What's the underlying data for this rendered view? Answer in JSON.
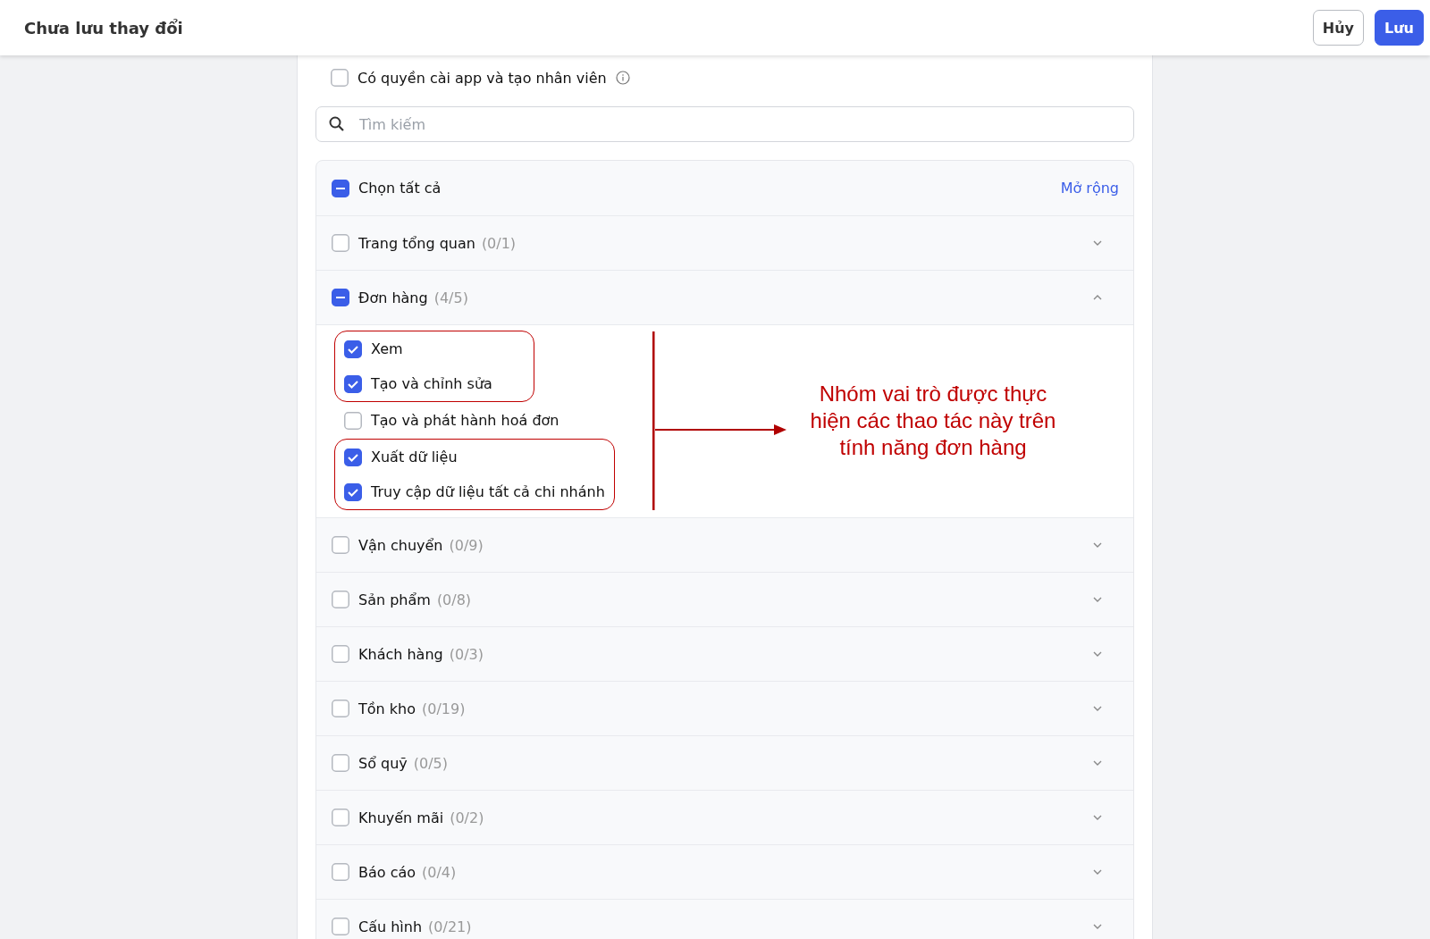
{
  "header": {
    "title": "Chưa lưu thay đổi",
    "buttons": [
      {
        "label": "Hủy",
        "kind": "secondary"
      },
      {
        "label": "Lưu",
        "kind": "primary"
      }
    ]
  },
  "install_permission": {
    "label": "Có quyền cài app và tạo nhân viên",
    "checked": false
  },
  "search": {
    "placeholder": "Tìm kiếm"
  },
  "select_all": {
    "label": "Chọn tất cả",
    "checked": false,
    "indeterminate": true,
    "action": "Mở rộng"
  },
  "categories": [
    {
      "label": "Trang tổng quan",
      "count": "(0/1)",
      "checked": false,
      "indeterminate": false,
      "expanded": false
    },
    {
      "label": "Đơn hàng",
      "count": "(4/5)",
      "checked": false,
      "indeterminate": true,
      "expanded": true,
      "groups": [
        {
          "highlighted": true,
          "items": [
            {
              "label": "Xem",
              "checked": true
            },
            {
              "label": "Tạo và chỉnh sửa",
              "checked": true
            }
          ]
        },
        {
          "highlighted": false,
          "items": [
            {
              "label": "Tạo và phát hành hoá đơn",
              "checked": false
            }
          ]
        },
        {
          "highlighted": true,
          "items": [
            {
              "label": "Xuất dữ liệu",
              "checked": true
            },
            {
              "label": "Truy cập dữ liệu tất cả chi nhánh",
              "checked": true
            }
          ]
        }
      ],
      "annotation": "Nhóm vai trò được thực hiện các thao tác này trên tính năng đơn hàng"
    },
    {
      "label": "Vận chuyển",
      "count": "(0/9)",
      "checked": false,
      "indeterminate": false,
      "expanded": false
    },
    {
      "label": "Sản phẩm",
      "count": "(0/8)",
      "checked": false,
      "indeterminate": false,
      "expanded": false
    },
    {
      "label": "Khách hàng",
      "count": "(0/3)",
      "checked": false,
      "indeterminate": false,
      "expanded": false
    },
    {
      "label": "Tồn kho",
      "count": "(0/19)",
      "checked": false,
      "indeterminate": false,
      "expanded": false
    },
    {
      "label": "Sổ quỹ",
      "count": "(0/5)",
      "checked": false,
      "indeterminate": false,
      "expanded": false
    },
    {
      "label": "Khuyến mãi",
      "count": "(0/2)",
      "checked": false,
      "indeterminate": false,
      "expanded": false
    },
    {
      "label": "Báo cáo",
      "count": "(0/4)",
      "checked": false,
      "indeterminate": false,
      "expanded": false
    },
    {
      "label": "Cấu hình",
      "count": "(0/21)",
      "checked": false,
      "indeterminate": false,
      "expanded": false
    }
  ]
}
